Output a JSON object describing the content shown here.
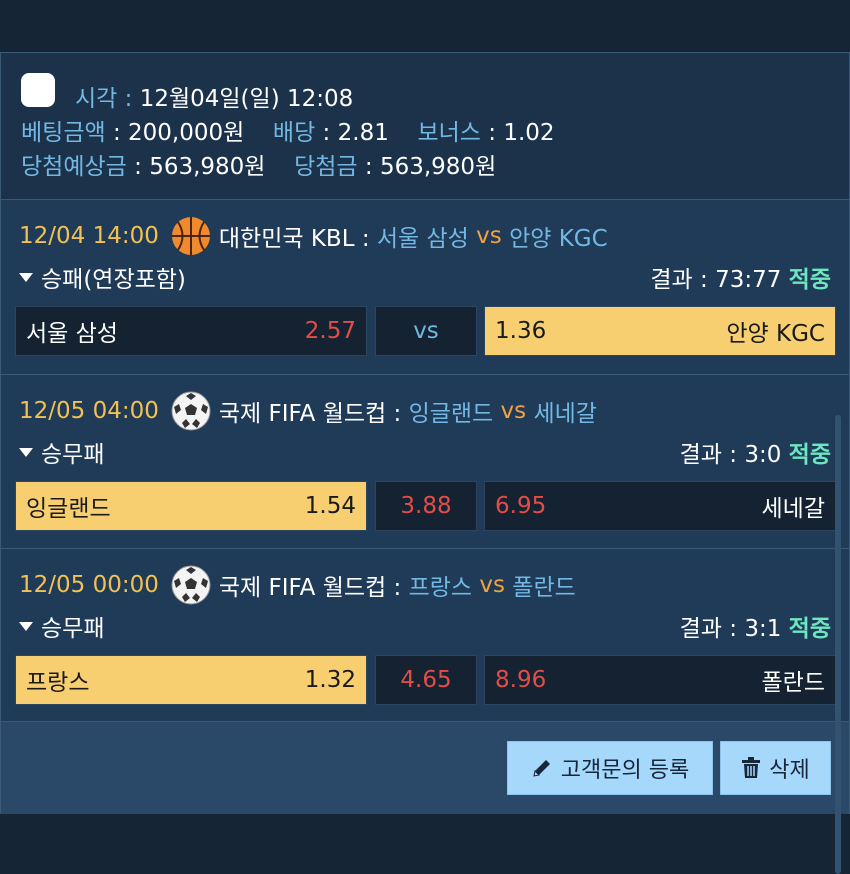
{
  "summary": {
    "time_label": "시각",
    "time_value": "12월04일(일) 12:08",
    "bet_amount_label": "베팅금액",
    "bet_amount_value": "200,000원",
    "odds_label": "배당",
    "odds_value": "2.81",
    "bonus_label": "보너스",
    "bonus_value": "1.02",
    "expected_label": "당첨예상금",
    "expected_value": "563,980원",
    "win_label": "당첨금",
    "win_value": "563,980원"
  },
  "matches": [
    {
      "time": "12/04 14:00",
      "sport_icon": "basketball-icon",
      "league": "대한민국 KBL :",
      "home_team": "서울 삼성",
      "vs": "vs",
      "away_team": "안양 KGC",
      "bet_type": "승패(연장포함)",
      "result_label": "결과 : 73:77",
      "result_status": "적중",
      "home_name": "서울 삼성",
      "home_odds": "2.57",
      "mid": "vs",
      "away_odds": "1.36",
      "away_name": "안양 KGC",
      "selected": "away"
    },
    {
      "time": "12/05 04:00",
      "sport_icon": "soccer-ball-icon",
      "league": "국제 FIFA 월드컵 :",
      "home_team": "잉글랜드",
      "vs": "vs",
      "away_team": "세네갈",
      "bet_type": "승무패",
      "result_label": "결과 : 3:0",
      "result_status": "적중",
      "home_name": "잉글랜드",
      "home_odds": "1.54",
      "mid": "3.88",
      "away_odds": "6.95",
      "away_name": "세네갈",
      "selected": "home"
    },
    {
      "time": "12/05 00:00",
      "sport_icon": "soccer-ball-icon",
      "league": "국제 FIFA 월드컵 :",
      "home_team": "프랑스",
      "vs": "vs",
      "away_team": "폴란드",
      "bet_type": "승무패",
      "result_label": "결과 : 3:1",
      "result_status": "적중",
      "home_name": "프랑스",
      "home_odds": "1.32",
      "mid": "4.65",
      "away_odds": "8.96",
      "away_name": "폴란드",
      "selected": "home"
    }
  ],
  "actions": {
    "register_label": "고객문의 등록",
    "delete_label": "삭제"
  },
  "colors": {
    "background": "#152536",
    "card": "#1f3b58",
    "selected": "#f7cf71",
    "label": "#72b8e3",
    "time": "#f3c152",
    "hit": "#6ee6c0",
    "odds_red": "#e24d48",
    "button": "#a6d8fb"
  }
}
